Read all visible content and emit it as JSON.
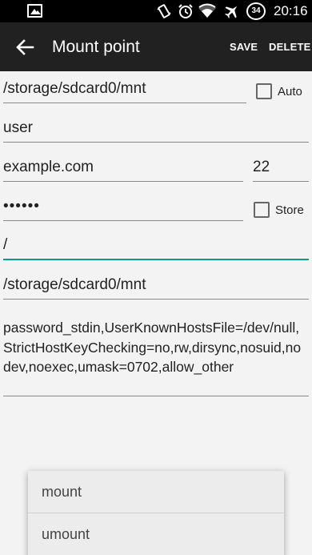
{
  "status_bar": {
    "time": "20:16",
    "battery_level": "34",
    "icons": [
      "gallery-icon",
      "vibrate-icon",
      "alarm-icon",
      "wifi-icon",
      "airplane-icon",
      "battery-icon"
    ]
  },
  "toolbar": {
    "title": "Mount point",
    "save_label": "SAVE",
    "delete_label": "DELETE"
  },
  "form": {
    "remote_path": "/storage/sdcard0/mnt",
    "auto_label": "Auto",
    "auto_checked": false,
    "username": "user",
    "host": "example.com",
    "port": "22",
    "password": "••••••",
    "store_label": "Store",
    "store_checked": false,
    "root_path": "/",
    "local_path": "/storage/sdcard0/mnt",
    "options": "password_stdin,UserKnownHostsFile=/dev/null,StrictHostKeyChecking=no,rw,dirsync,nosuid,nodev,noexec,umask=0702,allow_other"
  },
  "menu": {
    "items": [
      "mount",
      "umount"
    ]
  },
  "colors": {
    "accent": "#0c9a8e",
    "toolbar": "#212121",
    "background": "#f3f3f3"
  }
}
